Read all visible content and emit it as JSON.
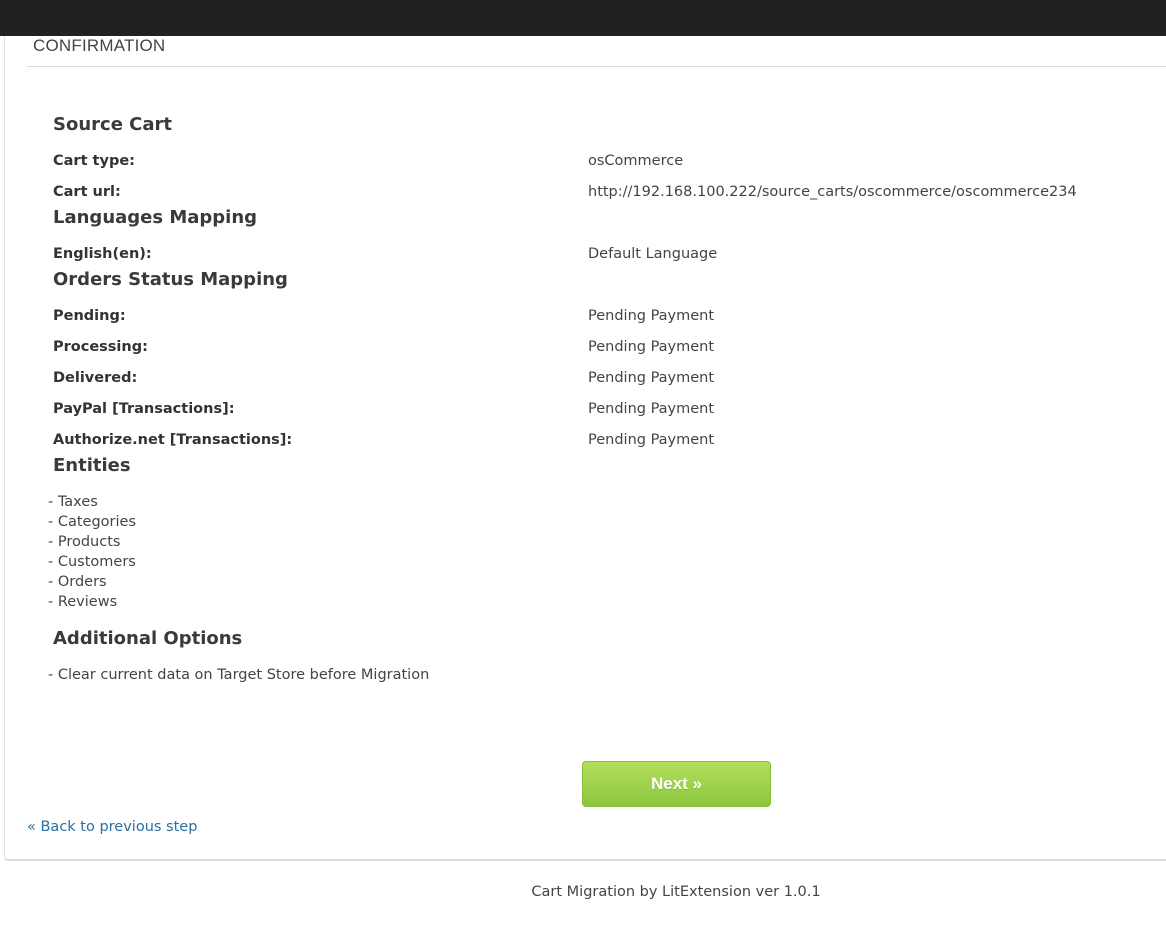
{
  "page": {
    "heading": "CONFIRMATION"
  },
  "source_cart": {
    "title": "Source Cart",
    "rows": [
      {
        "label": "Cart type:",
        "value": "osCommerce"
      },
      {
        "label": "Cart url:",
        "value": "http://192.168.100.222/source_carts/oscommerce/oscommerce234"
      }
    ]
  },
  "languages_mapping": {
    "title": "Languages Mapping",
    "rows": [
      {
        "label": "English(en):",
        "value": "Default Language"
      }
    ]
  },
  "orders_status_mapping": {
    "title": "Orders Status Mapping",
    "rows": [
      {
        "label": "Pending:",
        "value": "Pending Payment"
      },
      {
        "label": "Processing:",
        "value": "Pending Payment"
      },
      {
        "label": "Delivered:",
        "value": "Pending Payment"
      },
      {
        "label": "PayPal [Transactions]:",
        "value": "Pending Payment"
      },
      {
        "label": "Authorize.net [Transactions]:",
        "value": "Pending Payment"
      }
    ]
  },
  "entities": {
    "title": "Entities",
    "items": [
      "- Taxes",
      "- Categories",
      "- Products",
      "- Customers",
      "- Orders",
      "- Reviews"
    ]
  },
  "additional_options": {
    "title": "Additional Options",
    "items": [
      "- Clear current data on Target Store before Migration"
    ]
  },
  "actions": {
    "next_label": "Next »",
    "back_label": "« Back to previous step"
  },
  "footer": {
    "text": "Cart Migration by LitExtension ver 1.0.1"
  },
  "colors": {
    "topbar": "#212121",
    "button_green": "#8cc63f",
    "link_blue": "#2a6fa0"
  }
}
